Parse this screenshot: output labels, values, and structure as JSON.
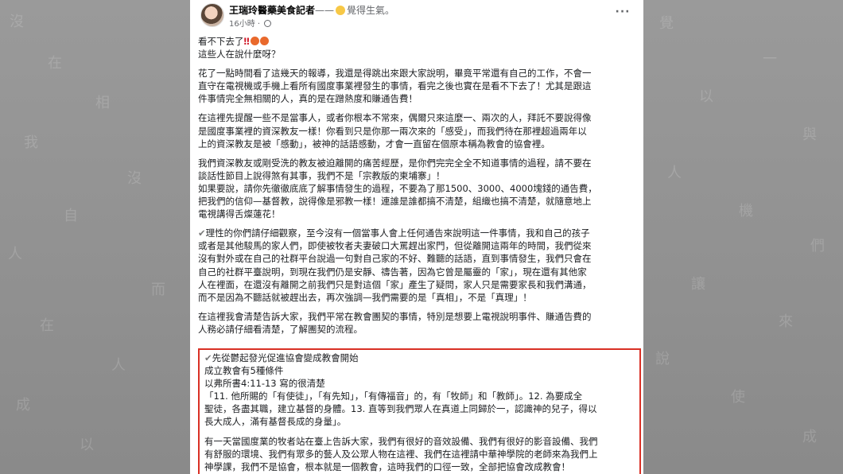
{
  "background": {
    "left_ghost": [
      "沒",
      "在",
      "相",
      "我",
      "沒",
      "自",
      "人",
      "而",
      "在",
      "人",
      "成",
      "以"
    ],
    "right_ghost": [
      "覺",
      "一",
      "以",
      "與",
      "人",
      "機",
      "們",
      "讓",
      "來",
      "說",
      "使",
      "成"
    ]
  },
  "post": {
    "author": "王瑞玲醫藥美食記者",
    "feeling_prefix": "——",
    "feeling": "覺得生氣。",
    "time": "16小時",
    "more_label": "···",
    "opening": {
      "line1": "看不下去了",
      "bangs": "‼",
      "line2": "這些人在說什麼呀？"
    },
    "paragraphs": [
      [
        "花了一點時間看了這幾天的報導，我還是得跳出來跟大家說明，畢竟平常還有自己的工作，不會一",
        "直守在電視機或手機上看所有國度事業裡發生的事情，看完之後也實在是看不下去了！尤其是跟這",
        "件事情完全無相關的人，真的是在蹭熱度和賺通告費！"
      ],
      [
        "在這裡先提醒一些不是當事人，或者你根本不常來，偶爾只來這麼一、兩次的人，拜託不要說得像",
        "是國度事業裡的資深教友一樣！你看到只是你那一兩次來的「感受」，而我們待在那裡超過兩年以",
        "上的資深教友是被「感動」，被神的話語感動，才會一直留在個原本稱為教會的協會裡。"
      ],
      [
        "我們資深教友或剛受洗的教友被迫離開的痛苦經歷，是你們完完全全不知道事情的過程，請不要在",
        "談話性節目上說得煞有其事，我們不是「宗教版的柬埔寨」！",
        "如果要說，請你先徹徹底底了解事情發生的過程，不要為了那1500、3000、4000塊錢的通告費，",
        "把我們的信仰—基督教，說得像是邪教一樣！連誰是誰都搞不清楚，組織也搞不清楚，就隨意地上",
        "電視講得舌燦蓮花！"
      ],
      [
        "理性的你們請仔細觀察，至今沒有一個當事人會上任何通告來說明這一件事情，我和自己的孩子",
        "或者是其他駿馬的家人們，即使被牧者夫妻破口大罵趕出家門，但從離開這兩年的時間，我們從來",
        "沒有對外或在自己的社群平台說過一句對自己家的不好、難聽的話語，直到事情發生，我們只會在",
        "自己的社群平臺說明，到現在我們仍是安靜、禱告著，因為它曾是屬靈的「家」，現在還有其他家",
        "人在裡面，在還沒有離開之前我們只是對這個「家」產生了疑問，家人只是需要家長和我們溝通，",
        "而不是因為不聽話就被趕出去，再次強調—我們需要的是「真相」，不是「真理」！"
      ],
      [
        "在這裡我會清楚告訴大家，我們平常在教會團契的事情，特別是想要上電視說明事件、賺通告費的",
        "人務必請仔細看清楚，了解團契的流程。"
      ]
    ],
    "boxed": {
      "header": "先從鬱起發光促進協會變成教會開始",
      "condition": "成立教會有5種條件",
      "scripture_ref": "以弗所書4:11-13 寫的很清楚",
      "verse": [
        "「11. 他所賜的「有使徒」，「有先知」，「有傳福音」的，有「牧師」和「教師」。12. 為要成全",
        "聖徒，各盡其職，建立基督的身體。13. 直等到我們眾人在真道上同歸於一，認識神的兒子，得以",
        "長大成人，滿有基督長成的身量」。"
      ],
      "closing": [
        "有一天當國度業的牧者站在臺上告訴大家，我們有很好的音效設備、我們有很好的影音設備、我們",
        "有舒服的環境、我們有眾多的藝人及公眾人物在這裡、我們在這裡請中華神學院的老師來為我們上",
        "神學課，我們不是協會，根本就是一個教會，這時我們的口徑一致，全部把協會改成教會！"
      ]
    }
  },
  "colors": {
    "box_border": "#d93025",
    "text": "#1c1e21",
    "meta": "#65676b"
  }
}
